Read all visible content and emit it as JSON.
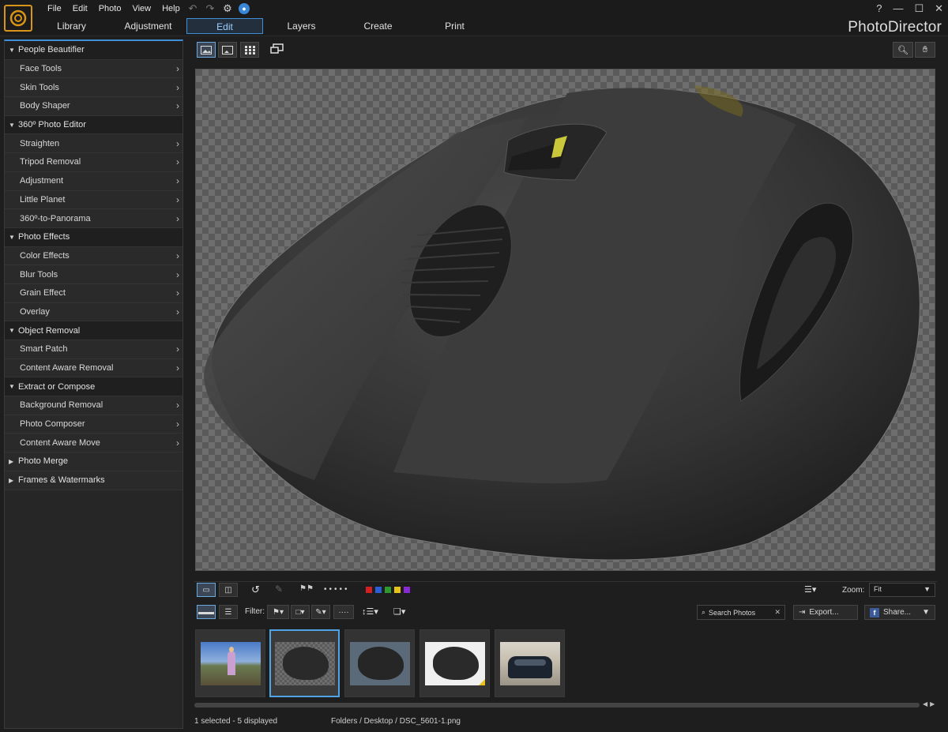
{
  "app": {
    "brand": "PhotoDirector"
  },
  "menu": [
    "File",
    "Edit",
    "Photo",
    "View",
    "Help"
  ],
  "quick_actions": [
    "undo-icon",
    "redo-icon",
    "gear-icon",
    "notification-icon"
  ],
  "window_controls": [
    "?",
    "—",
    "☐",
    "✕"
  ],
  "tabs": [
    {
      "label": "Library",
      "active": false
    },
    {
      "label": "Adjustment",
      "active": false
    },
    {
      "label": "Edit",
      "active": true
    },
    {
      "label": "Layers",
      "active": false
    },
    {
      "label": "Create",
      "active": false
    },
    {
      "label": "Print",
      "active": false
    }
  ],
  "panel": {
    "sections": [
      {
        "title": "People Beautifier",
        "expanded": true,
        "items": [
          "Face Tools",
          "Skin Tools",
          "Body Shaper"
        ]
      },
      {
        "title": "360º Photo Editor",
        "expanded": true,
        "items": [
          "Straighten",
          "Tripod Removal",
          "Adjustment",
          "Little Planet",
          "360º-to-Panorama"
        ]
      },
      {
        "title": "Photo Effects",
        "expanded": true,
        "items": [
          "Color Effects",
          "Blur Tools",
          "Grain Effect",
          "Overlay"
        ]
      },
      {
        "title": "Object Removal",
        "expanded": true,
        "items": [
          "Smart Patch",
          "Content Aware Removal"
        ]
      },
      {
        "title": "Extract or Compose",
        "expanded": true,
        "items": [
          "Background Removal",
          "Photo Composer",
          "Content Aware Move"
        ]
      },
      {
        "title": "Photo Merge",
        "expanded": false,
        "items": []
      },
      {
        "title": "Frames & Watermarks",
        "expanded": false,
        "items": []
      }
    ]
  },
  "viewer": {
    "zoom_label": "Zoom:",
    "zoom_value": "Fit",
    "filter_label": "Filter:",
    "search_placeholder": "Search Photos",
    "export_label": "Export...",
    "share_label": "Share...",
    "color_labels": [
      "#d42020",
      "#2a5fd6",
      "#2e9a2e",
      "#e6c21a",
      "#8a2ad6"
    ]
  },
  "filmstrip": {
    "selected_index": 1,
    "thumbs": [
      "child-outdoors-photo",
      "mouse-transparent-photo",
      "mouse-photo",
      "mouse-white-bg-photo",
      "car-photo"
    ]
  },
  "status": {
    "selection": "1 selected - 5 displayed",
    "path": "Folders / Desktop / DSC_5601-1.png"
  }
}
